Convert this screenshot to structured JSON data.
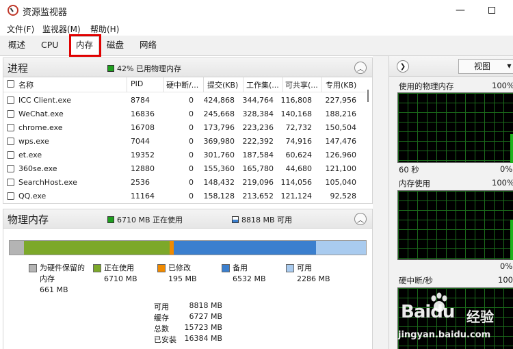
{
  "window": {
    "title": "资源监视器"
  },
  "menu": [
    "文件(F)",
    "监视器(M)",
    "帮助(H)"
  ],
  "tabs": [
    "概述",
    "CPU",
    "内存",
    "磁盘",
    "网络"
  ],
  "active_tab": "内存",
  "process_panel": {
    "title": "进程",
    "status": "42% 已用物理内存",
    "status_color": "#1f9f1f",
    "columns": [
      "名称",
      "PID",
      "硬中断/...",
      "提交(KB)",
      "工作集(...",
      "可共享(...",
      "专用(KB)"
    ],
    "rows": [
      [
        "ICC Client.exe",
        "8784",
        "0",
        "424,868",
        "344,764",
        "116,808",
        "227,956"
      ],
      [
        "WeChat.exe",
        "16836",
        "0",
        "245,668",
        "328,384",
        "140,168",
        "188,216"
      ],
      [
        "chrome.exe",
        "16708",
        "0",
        "173,796",
        "223,236",
        "72,732",
        "150,504"
      ],
      [
        "wps.exe",
        "7044",
        "0",
        "369,980",
        "222,392",
        "74,916",
        "147,476"
      ],
      [
        "et.exe",
        "19352",
        "0",
        "301,760",
        "187,584",
        "60,624",
        "126,960"
      ],
      [
        "360se.exe",
        "12880",
        "0",
        "155,360",
        "165,780",
        "44,680",
        "121,100"
      ],
      [
        "SearchHost.exe",
        "2536",
        "0",
        "148,432",
        "219,096",
        "114,056",
        "105,040"
      ],
      [
        "QQ.exe",
        "11164",
        "0",
        "158,128",
        "213,652",
        "121,124",
        "92,528"
      ]
    ]
  },
  "memory_panel": {
    "title": "物理内存",
    "in_use_status": "6710 MB 正在使用",
    "available_status": "8818 MB 可用",
    "legend": [
      {
        "label": "为硬件保留的内存",
        "value": "661 MB",
        "color": "#b4b4b4"
      },
      {
        "label": "正在使用",
        "value": "6710 MB",
        "color": "#7ca82a"
      },
      {
        "label": "已修改",
        "value": "195 MB",
        "color": "#f08a00"
      },
      {
        "label": "备用",
        "value": "6532 MB",
        "color": "#3b7fce"
      },
      {
        "label": "可用",
        "value": "2286 MB",
        "color": "#a9cbef"
      }
    ],
    "summary": [
      {
        "key": "可用",
        "value": "8818 MB"
      },
      {
        "key": "缓存",
        "value": "6727 MB"
      },
      {
        "key": "总数",
        "value": "15723 MB"
      },
      {
        "key": "已安装",
        "value": "16384 MB"
      }
    ]
  },
  "right_pane": {
    "view_label": "视图",
    "graphs": [
      {
        "title": "使用的物理内存",
        "max": "100%",
        "footer_left": "60 秒",
        "footer_right": "0%"
      },
      {
        "title": "内存使用",
        "max": "100%",
        "footer_left": "",
        "footer_right": "0%"
      },
      {
        "title": "硬中断/秒",
        "max": "100",
        "footer_left": "",
        "footer_right": ""
      }
    ]
  },
  "watermark": {
    "brand": "Baidu",
    "product": "经验",
    "url": "jingyan.baidu.com"
  }
}
